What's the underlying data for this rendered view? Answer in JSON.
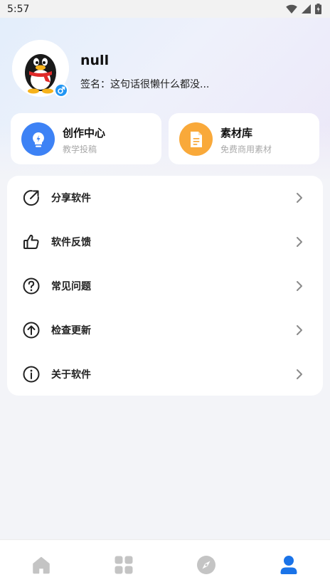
{
  "status_bar": {
    "time": "5:57"
  },
  "profile": {
    "username": "null",
    "signature": "签名：这句话很懒什么都没..."
  },
  "cards": [
    {
      "title": "创作中心",
      "subtitle": "教学投稿",
      "icon": "lightbulb-icon",
      "color": "#3d82f5"
    },
    {
      "title": "素材库",
      "subtitle": "免费商用素材",
      "icon": "document-icon",
      "color": "#f9a93a"
    }
  ],
  "menu": {
    "items": [
      {
        "label": "分享软件",
        "icon": "share-icon"
      },
      {
        "label": "软件反馈",
        "icon": "thumbs-up-icon"
      },
      {
        "label": "常见问题",
        "icon": "question-icon"
      },
      {
        "label": "检查更新",
        "icon": "upload-icon"
      },
      {
        "label": "关于软件",
        "icon": "info-icon"
      }
    ]
  },
  "bottom_nav": {
    "items": [
      {
        "name": "home",
        "icon": "home-icon",
        "active": false
      },
      {
        "name": "apps",
        "icon": "grid-icon",
        "active": false
      },
      {
        "name": "discover",
        "icon": "compass-icon",
        "active": false
      },
      {
        "name": "profile",
        "icon": "person-icon",
        "active": true
      }
    ],
    "active_color": "#1a73e8",
    "inactive_color": "#c4c4c4"
  }
}
